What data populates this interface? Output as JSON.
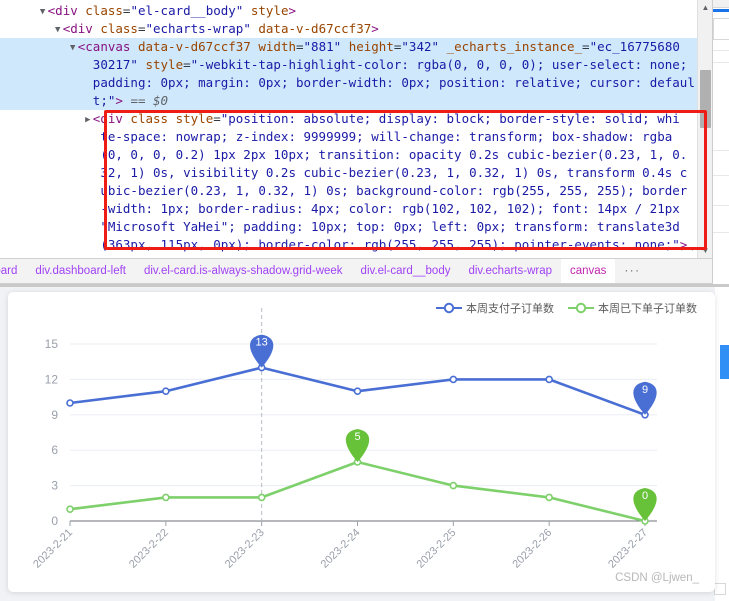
{
  "devtools": {
    "tree_lines": [
      {
        "indent": 5,
        "selected": false,
        "triangle": "▼",
        "parts": [
          {
            "t": "punc",
            "s": "<"
          },
          {
            "t": "tag",
            "s": "div"
          },
          {
            "t": "attr",
            "s": " class"
          },
          {
            "t": "plain",
            "s": "="
          },
          {
            "t": "val",
            "s": "\"el-card__body\""
          },
          {
            "t": "attr",
            "s": " style"
          },
          {
            "t": "punc",
            "s": ">"
          }
        ]
      },
      {
        "indent": 7,
        "selected": false,
        "triangle": "▼",
        "parts": [
          {
            "t": "punc",
            "s": "<"
          },
          {
            "t": "tag",
            "s": "div"
          },
          {
            "t": "attr",
            "s": " class"
          },
          {
            "t": "plain",
            "s": "="
          },
          {
            "t": "val",
            "s": "\"echarts-wrap\""
          },
          {
            "t": "attr",
            "s": " data-v-d67ccf37"
          },
          {
            "t": "punc",
            "s": ">"
          }
        ]
      },
      {
        "indent": 9,
        "selected": true,
        "triangle": "▼",
        "parts": [
          {
            "t": "punc",
            "s": "<"
          },
          {
            "t": "tag",
            "s": "canvas"
          },
          {
            "t": "attr",
            "s": " data-v-d67ccf37"
          },
          {
            "t": "attr",
            "s": " width"
          },
          {
            "t": "plain",
            "s": "="
          },
          {
            "t": "val",
            "s": "\"881\""
          },
          {
            "t": "attr",
            "s": " height"
          },
          {
            "t": "plain",
            "s": "="
          },
          {
            "t": "val",
            "s": "\"342\""
          },
          {
            "t": "attr",
            "s": " _echarts_instance_"
          },
          {
            "t": "plain",
            "s": "="
          },
          {
            "t": "val",
            "s": "\"ec_16775680"
          }
        ]
      },
      {
        "indent": 11,
        "selected": true,
        "triangle": "",
        "parts": [
          {
            "t": "val",
            "s": "30217\""
          },
          {
            "t": "attr",
            "s": " style"
          },
          {
            "t": "plain",
            "s": "="
          },
          {
            "t": "val",
            "s": "\"-webkit-tap-highlight-color: rgba(0, 0, 0, 0); user-select: none;"
          }
        ]
      },
      {
        "indent": 11,
        "selected": true,
        "triangle": "",
        "parts": [
          {
            "t": "val",
            "s": "padding: 0px; margin: 0px; border-width: 0px; position: relative; cursor: defaul"
          }
        ]
      },
      {
        "indent": 11,
        "selected": true,
        "triangle": "",
        "parts": [
          {
            "t": "val",
            "s": "t;\""
          },
          {
            "t": "punc",
            "s": "> "
          },
          {
            "t": "dollar",
            "s": "== $0"
          }
        ]
      },
      {
        "indent": 11,
        "selected": false,
        "triangle": "▶",
        "parts": [
          {
            "t": "punc",
            "s": "<"
          },
          {
            "t": "tag",
            "s": "div"
          },
          {
            "t": "attr",
            "s": " class"
          },
          {
            "t": "attr",
            "s": " style"
          },
          {
            "t": "plain",
            "s": "="
          },
          {
            "t": "val",
            "s": "\"position: absolute; display: block; border-style: solid; whi"
          }
        ]
      },
      {
        "indent": 12,
        "selected": false,
        "triangle": "",
        "parts": [
          {
            "t": "val",
            "s": "te-space: nowrap; z-index: 9999999; will-change: transform; box-shadow: rgba"
          }
        ]
      },
      {
        "indent": 12,
        "selected": false,
        "triangle": "",
        "parts": [
          {
            "t": "val",
            "s": "(0, 0, 0, 0.2) 1px 2px 10px; transition: opacity 0.2s cubic-bezier(0.23, 1, 0."
          }
        ]
      },
      {
        "indent": 12,
        "selected": false,
        "triangle": "",
        "parts": [
          {
            "t": "val",
            "s": "32, 1) 0s, visibility 0.2s cubic-bezier(0.23, 1, 0.32, 1) 0s, transform 0.4s c"
          }
        ]
      },
      {
        "indent": 12,
        "selected": false,
        "triangle": "",
        "parts": [
          {
            "t": "val",
            "s": "ubic-bezier(0.23, 1, 0.32, 1) 0s; background-color: rgb(255, 255, 255); border"
          }
        ]
      },
      {
        "indent": 12,
        "selected": false,
        "triangle": "",
        "parts": [
          {
            "t": "val",
            "s": "-width: 1px; border-radius: 4px; color: rgb(102, 102, 102); font: 14px / 21px"
          }
        ]
      },
      {
        "indent": 12,
        "selected": false,
        "triangle": "",
        "parts": [
          {
            "t": "val",
            "s": "\"Microsoft YaHei\"; padding: 10px; top: 0px; left: 0px; transform: translate3d"
          }
        ]
      },
      {
        "indent": 12,
        "selected": false,
        "triangle": "",
        "parts": [
          {
            "t": "val",
            "s": "(363px, 115px, 0px); border-color: rgb(255, 255, 255); pointer-events: none;\""
          },
          {
            "t": "punc",
            "s": ">"
          }
        ]
      }
    ],
    "scrollbar": {
      "up_arrow": "▲",
      "down_arrow": "▼"
    },
    "more_dots": "· · ·",
    "breadcrumb": {
      "items": [
        {
          "label": "board",
          "active": false
        },
        {
          "label": "div.dashboard-left",
          "active": false
        },
        {
          "label": "div.el-card.is-always-shadow.grid-week",
          "active": false
        },
        {
          "label": "div.el-card__body",
          "active": false
        },
        {
          "label": "div.echarts-wrap",
          "active": false
        },
        {
          "label": "canvas",
          "active": true
        }
      ],
      "overflow": "···"
    }
  },
  "chart_data": {
    "type": "line",
    "title": "",
    "xlabel": "",
    "ylabel": "",
    "grid": true,
    "legend_position": "top-right",
    "ylim": [
      0,
      15
    ],
    "yticks": [
      "0",
      "3",
      "6",
      "9",
      "12",
      "15"
    ],
    "categories": [
      "2023-2-21",
      "2023-2-22",
      "2023-2-23",
      "2023-2-24",
      "2023-2-25",
      "2023-2-26",
      "2023-2-27"
    ],
    "series": [
      {
        "name": "本周支付子订单数",
        "color": "#4a6fd4",
        "values": [
          10,
          11,
          13,
          11,
          12,
          12,
          9
        ],
        "pins": [
          {
            "index": 2,
            "label": "13"
          },
          {
            "index": 6,
            "label": "9"
          }
        ]
      },
      {
        "name": "本周已下单子订单数",
        "color": "#67c23a",
        "line_color": "#7ed06b",
        "values": [
          1,
          2,
          2,
          5,
          3,
          2,
          0
        ],
        "pins": [
          {
            "index": 3,
            "label": "5"
          },
          {
            "index": 6,
            "label": "0"
          }
        ]
      }
    ],
    "axis_pointer": {
      "category": "2023-2-23",
      "style": "dashed"
    }
  },
  "page": {
    "watermark": "CSDN @Ljwen_"
  }
}
